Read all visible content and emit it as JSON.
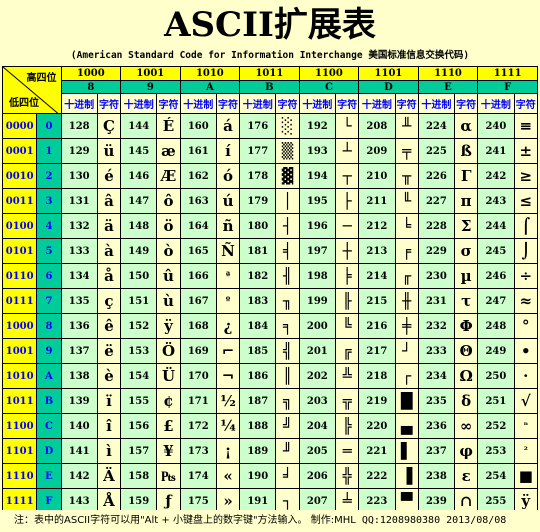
{
  "title": "ASCII扩展表",
  "subtitle": "(American Standard Code for Information Interchange 美国标准信息交换代码)",
  "header": {
    "high_label": "高四位",
    "low_label": "低四位",
    "dec_label": "十进制",
    "char_label": "字符",
    "high_bits": [
      "1000",
      "1001",
      "1010",
      "1011",
      "1100",
      "1101",
      "1110",
      "1111"
    ],
    "high_hex": [
      "8",
      "9",
      "A",
      "B",
      "C",
      "D",
      "E",
      "F"
    ]
  },
  "rows": [
    {
      "bin": "0000",
      "hex": "0",
      "cells": [
        [
          "128",
          "Ç"
        ],
        [
          "144",
          "É"
        ],
        [
          "160",
          "á"
        ],
        [
          "176",
          "░"
        ],
        [
          "192",
          "└"
        ],
        [
          "208",
          "╨"
        ],
        [
          "224",
          "α"
        ],
        [
          "240",
          "≡"
        ]
      ]
    },
    {
      "bin": "0001",
      "hex": "1",
      "cells": [
        [
          "129",
          "ü"
        ],
        [
          "145",
          "æ"
        ],
        [
          "161",
          "í"
        ],
        [
          "177",
          "▒"
        ],
        [
          "193",
          "┴"
        ],
        [
          "209",
          "╤"
        ],
        [
          "225",
          "ß"
        ],
        [
          "241",
          "±"
        ]
      ]
    },
    {
      "bin": "0010",
      "hex": "2",
      "cells": [
        [
          "130",
          "é"
        ],
        [
          "146",
          "Æ"
        ],
        [
          "162",
          "ó"
        ],
        [
          "178",
          "▓"
        ],
        [
          "194",
          "┬"
        ],
        [
          "210",
          "╥"
        ],
        [
          "226",
          "Γ"
        ],
        [
          "242",
          "≥"
        ]
      ]
    },
    {
      "bin": "0011",
      "hex": "3",
      "cells": [
        [
          "131",
          "â"
        ],
        [
          "147",
          "ô"
        ],
        [
          "163",
          "ú"
        ],
        [
          "179",
          "│"
        ],
        [
          "195",
          "├"
        ],
        [
          "211",
          "╙"
        ],
        [
          "227",
          "π"
        ],
        [
          "243",
          "≤"
        ]
      ]
    },
    {
      "bin": "0100",
      "hex": "4",
      "cells": [
        [
          "132",
          "ä"
        ],
        [
          "148",
          "ö"
        ],
        [
          "164",
          "ñ"
        ],
        [
          "180",
          "┤"
        ],
        [
          "196",
          "─"
        ],
        [
          "212",
          "╘"
        ],
        [
          "228",
          "Σ"
        ],
        [
          "244",
          "⌠"
        ]
      ]
    },
    {
      "bin": "0101",
      "hex": "5",
      "cells": [
        [
          "133",
          "à"
        ],
        [
          "149",
          "ò"
        ],
        [
          "165",
          "Ñ"
        ],
        [
          "181",
          "╡"
        ],
        [
          "197",
          "┼"
        ],
        [
          "213",
          "╒"
        ],
        [
          "229",
          "σ"
        ],
        [
          "245",
          "⌡"
        ]
      ]
    },
    {
      "bin": "0110",
      "hex": "6",
      "cells": [
        [
          "134",
          "å"
        ],
        [
          "150",
          "û"
        ],
        [
          "166",
          "ª"
        ],
        [
          "182",
          "╢"
        ],
        [
          "198",
          "╞"
        ],
        [
          "214",
          "╓"
        ],
        [
          "230",
          "µ"
        ],
        [
          "246",
          "÷"
        ]
      ]
    },
    {
      "bin": "0111",
      "hex": "7",
      "cells": [
        [
          "135",
          "ç"
        ],
        [
          "151",
          "ù"
        ],
        [
          "167",
          "º"
        ],
        [
          "183",
          "╖"
        ],
        [
          "199",
          "╟"
        ],
        [
          "215",
          "╫"
        ],
        [
          "231",
          "τ"
        ],
        [
          "247",
          "≈"
        ]
      ]
    },
    {
      "bin": "1000",
      "hex": "8",
      "cells": [
        [
          "136",
          "ê"
        ],
        [
          "152",
          "ÿ"
        ],
        [
          "168",
          "¿"
        ],
        [
          "184",
          "╕"
        ],
        [
          "200",
          "╚"
        ],
        [
          "216",
          "╪"
        ],
        [
          "232",
          "Φ"
        ],
        [
          "248",
          "°"
        ]
      ]
    },
    {
      "bin": "1001",
      "hex": "9",
      "cells": [
        [
          "137",
          "ë"
        ],
        [
          "153",
          "Ö"
        ],
        [
          "169",
          "⌐"
        ],
        [
          "185",
          "╣"
        ],
        [
          "201",
          "╔"
        ],
        [
          "217",
          "┘"
        ],
        [
          "233",
          "Θ"
        ],
        [
          "249",
          "•"
        ]
      ]
    },
    {
      "bin": "1010",
      "hex": "A",
      "cells": [
        [
          "138",
          "è"
        ],
        [
          "154",
          "Ü"
        ],
        [
          "170",
          "¬"
        ],
        [
          "186",
          "║"
        ],
        [
          "202",
          "╩"
        ],
        [
          "218",
          "┌"
        ],
        [
          "234",
          "Ω"
        ],
        [
          "250",
          "·"
        ]
      ]
    },
    {
      "bin": "1011",
      "hex": "B",
      "cells": [
        [
          "139",
          "ï"
        ],
        [
          "155",
          "¢"
        ],
        [
          "171",
          "½"
        ],
        [
          "187",
          "╗"
        ],
        [
          "203",
          "╦"
        ],
        [
          "219",
          "█"
        ],
        [
          "235",
          "δ"
        ],
        [
          "251",
          "√"
        ]
      ]
    },
    {
      "bin": "1100",
      "hex": "C",
      "cells": [
        [
          "140",
          "î"
        ],
        [
          "156",
          "£"
        ],
        [
          "172",
          "¼"
        ],
        [
          "188",
          "╝"
        ],
        [
          "204",
          "╠"
        ],
        [
          "220",
          "▄"
        ],
        [
          "236",
          "∞"
        ],
        [
          "252",
          "ⁿ"
        ]
      ]
    },
    {
      "bin": "1101",
      "hex": "D",
      "cells": [
        [
          "141",
          "ì"
        ],
        [
          "157",
          "¥"
        ],
        [
          "173",
          "¡"
        ],
        [
          "189",
          "╜"
        ],
        [
          "205",
          "═"
        ],
        [
          "221",
          "▌"
        ],
        [
          "237",
          "φ"
        ],
        [
          "253",
          "²"
        ]
      ]
    },
    {
      "bin": "1110",
      "hex": "E",
      "cells": [
        [
          "142",
          "Ä"
        ],
        [
          "158",
          "₧"
        ],
        [
          "174",
          "«"
        ],
        [
          "190",
          "╛"
        ],
        [
          "206",
          "╬"
        ],
        [
          "222",
          "▐"
        ],
        [
          "238",
          "ε"
        ],
        [
          "254",
          "■"
        ]
      ]
    },
    {
      "bin": "1111",
      "hex": "F",
      "cells": [
        [
          "143",
          "Å"
        ],
        [
          "159",
          "ƒ"
        ],
        [
          "175",
          "»"
        ],
        [
          "191",
          "┐"
        ],
        [
          "207",
          "╧"
        ],
        [
          "223",
          "▀"
        ],
        [
          "239",
          "∩"
        ],
        [
          "255",
          "ÿ"
        ]
      ]
    }
  ],
  "footnote": {
    "text": "注：表中的ASCII字符可以用\"Alt + 小键盘上的数字键\"方法输入。 制作:MHL",
    "tail": " QQ:1208980380  2013/08/08"
  },
  "colors": {
    "background": "#ffffcc",
    "highlight": "#ffff00",
    "decimal_bg": "#ccffcc",
    "hex_bg": "#00cc99",
    "accent": "#0000ff"
  }
}
